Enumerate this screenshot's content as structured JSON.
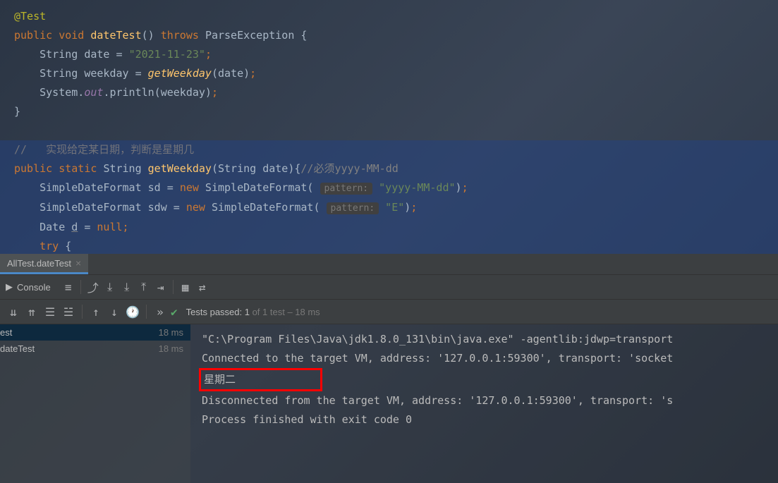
{
  "editor": {
    "annotation": "@Test",
    "line1": {
      "kw1": "public",
      "kw2": "void",
      "method": "dateTest",
      "parens": "()",
      "throws": "throws",
      "exception": "ParseException",
      "brace": " {"
    },
    "line2": {
      "type": "String",
      "var": "date",
      "eq": " = ",
      "str": "\"2021-11-23\"",
      "semi": ";"
    },
    "line3": {
      "type": "String",
      "var": "weekday",
      "eq": " = ",
      "method": "getWeekday",
      "args": "(date)",
      "semi": ";"
    },
    "line4": {
      "cls": "System.",
      "field": "out",
      "method": ".println(weekday)",
      "semi": ";"
    },
    "brace_close": "}",
    "comment1": "//   实现给定某日期，判断是星期几",
    "line6": {
      "kw1": "public",
      "kw2": "static",
      "type": "String",
      "method": "getWeekday",
      "args": "(String date){",
      "comment": "//必须yyyy-MM-dd"
    },
    "line7": {
      "type": "SimpleDateFormat",
      "var": "sd",
      "eq": " = ",
      "new": "new",
      "ctor": " SimpleDateFormat(",
      "hint": "pattern:",
      "str": " \"yyyy-MM-dd\"",
      "close": ")",
      "semi": ";"
    },
    "line8": {
      "type": "SimpleDateFormat",
      "var": "sdw",
      "eq": " = ",
      "new": "new",
      "ctor": " SimpleDateFormat(",
      "hint": "pattern:",
      "str": " \"E\"",
      "close": ")",
      "semi": ";"
    },
    "line9": {
      "type": "Date ",
      "var": "d",
      "eq": " = ",
      "null": "null",
      "semi": ";"
    },
    "line10": {
      "try": "try",
      "brace": " {"
    }
  },
  "tab": {
    "name": "AllTest.dateTest",
    "close": "×"
  },
  "console": {
    "label": "Console"
  },
  "test_status": {
    "passed_prefix": "Tests passed: 1",
    "rest": " of 1 test – 18 ms"
  },
  "tree": {
    "items": [
      {
        "name": "est",
        "time": "18 ms"
      },
      {
        "name": "dateTest",
        "time": "18 ms"
      }
    ]
  },
  "output": {
    "line1": "\"C:\\Program Files\\Java\\jdk1.8.0_131\\bin\\java.exe\" -agentlib:jdwp=transport",
    "line2": "Connected to the target VM, address: '127.0.0.1:59300', transport: 'socket",
    "line3": "星期二",
    "line4": "Disconnected from the target VM, address: '127.0.0.1:59300', transport: 's",
    "line5": "",
    "line6": "Process finished with exit code 0"
  }
}
